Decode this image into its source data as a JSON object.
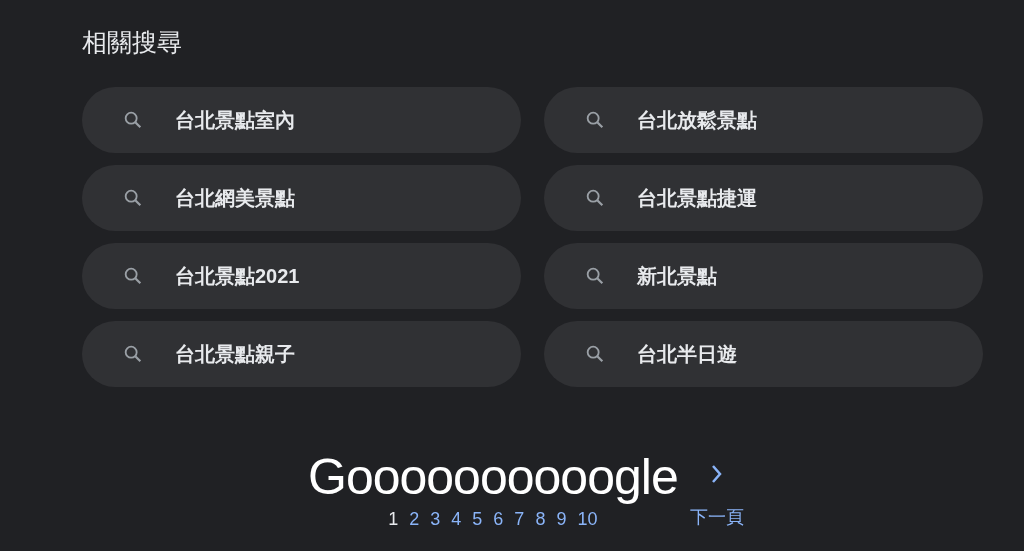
{
  "title": "相關搜尋",
  "searches": [
    {
      "text": "台北景點室內"
    },
    {
      "text": "台北放鬆景點"
    },
    {
      "text": "台北網美景點"
    },
    {
      "text": "台北景點捷運"
    },
    {
      "text": "台北景點2021"
    },
    {
      "text": "新北景點"
    },
    {
      "text": "台北景點親子"
    },
    {
      "text": "台北半日遊"
    }
  ],
  "pagination": {
    "logo": "Goooooooooogle",
    "pages": [
      {
        "label": "1",
        "selected": true
      },
      {
        "label": "2",
        "selected": false
      },
      {
        "label": "3",
        "selected": false
      },
      {
        "label": "4",
        "selected": false
      },
      {
        "label": "5",
        "selected": false
      },
      {
        "label": "6",
        "selected": false
      },
      {
        "label": "7",
        "selected": false
      },
      {
        "label": "8",
        "selected": false
      },
      {
        "label": "9",
        "selected": false
      },
      {
        "label": "10",
        "selected": false
      }
    ],
    "next": "下一頁"
  }
}
